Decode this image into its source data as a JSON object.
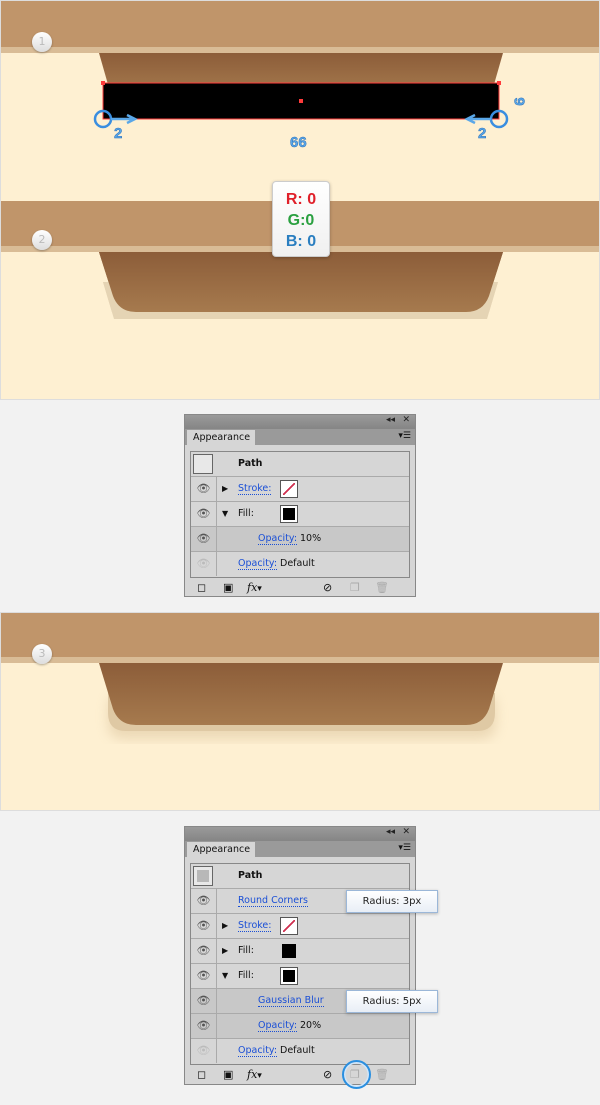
{
  "steps": [
    "1",
    "2",
    "3"
  ],
  "measurements": {
    "left": "2",
    "right": "2",
    "width": "66",
    "height": "9"
  },
  "color_box": {
    "r": "R: 0",
    "g": "G:0",
    "b": "B: 0"
  },
  "colors": {
    "band": "#c0956a",
    "background": "#fef0d2",
    "drawer": "#96673f",
    "accent_red": "#e0202a",
    "accent_green": "#2aa040",
    "accent_blue": "#2a7ec0"
  },
  "panel1": {
    "title": "Appearance",
    "rows": [
      {
        "label": "Path"
      },
      {
        "label": "Stroke:",
        "swatch": "stroke-none"
      },
      {
        "label": "Fill:",
        "swatch": "black"
      },
      {
        "label": "Opacity:",
        "value": "10%"
      },
      {
        "label": "Opacity:",
        "value": "Default"
      }
    ]
  },
  "panel2": {
    "title": "Appearance",
    "rows": [
      {
        "label": "Path"
      },
      {
        "label": "Round Corners",
        "tooltip": "Radius: 3px"
      },
      {
        "label": "Stroke:",
        "swatch": "stroke-none"
      },
      {
        "label": "Fill:",
        "swatch": "black"
      },
      {
        "label": "Fill:",
        "swatch": "black"
      },
      {
        "label": "Gaussian Blur",
        "tooltip": "Radius: 5px"
      },
      {
        "label": "Opacity:",
        "value": "20%"
      },
      {
        "label": "Opacity:",
        "value": "Default"
      }
    ]
  },
  "icons": {
    "eye": "eye-icon",
    "fx": "fx"
  }
}
